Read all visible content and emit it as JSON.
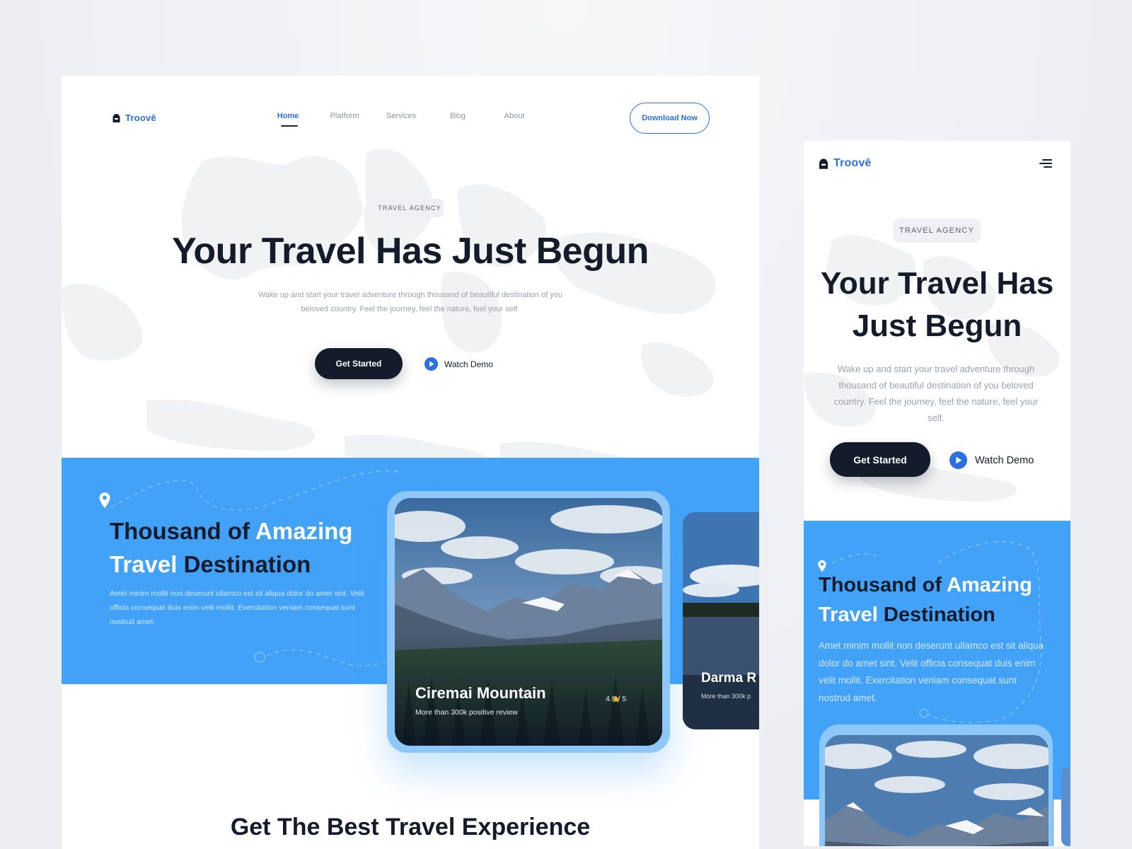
{
  "brand": {
    "name": "Troovē",
    "accent": "#2c6fe0",
    "dark": "#141b2b",
    "sky": "#42a2f8"
  },
  "desktop": {
    "nav": {
      "items": [
        {
          "label": "Home",
          "active": true
        },
        {
          "label": "Platform",
          "active": false
        },
        {
          "label": "Services",
          "active": false
        },
        {
          "label": "Blog",
          "active": false
        },
        {
          "label": "About",
          "active": false
        }
      ],
      "cta": "Download Now"
    },
    "hero": {
      "badge": "TRAVEL AGENCY",
      "title": "Your Travel Has Just Begun",
      "subtitle": "Wake up and start your travel adventure through thousand of beautiful destination of you beloved country. Feel the journey, feel the nature, feel your self.",
      "primary_button": "Get Started",
      "secondary_button": "Watch Demo",
      "secondary_icon": "play-icon"
    },
    "destinations": {
      "title_part1": "Thousand of ",
      "title_part2": "Amazing",
      "title_part3": "Travel",
      "title_part4": " Destination",
      "description": "Amet minim mollit non deserunt ullamco est sit aliqua dolor do amet sint. Velit officia consequat duis enim velit mollit. Exercitation veniam consequat sunt nostrud amet.",
      "pin_icon": "location-pin-icon",
      "cards": [
        {
          "name": "Ciremai Mountain",
          "review": "More than 300k positive review",
          "rating": "4.9 / 5"
        },
        {
          "name": "Darma R",
          "review": "More than 300k p"
        }
      ]
    },
    "next_section_title": "Get The Best Travel Experience"
  },
  "mobile": {
    "menu_icon": "menu-icon",
    "hero": {
      "badge": "TRAVEL AGENCY",
      "title_line1": "Your Travel Has",
      "title_line2": "Just Begun",
      "subtitle": "Wake up and start your travel  adventure through thousand of beautiful destination of you beloved country. Feel the journey, feel the nature, feel your self.",
      "primary_button": "Get Started",
      "secondary_button": "Watch Demo"
    },
    "destinations": {
      "title_part1": "Thousand of ",
      "title_part2": "Amazing",
      "title_part3": "Travel",
      "title_part4": " Destination",
      "description": "Amet minim mollit non deserunt ullamco est sit aliqua dolor do amet sint. Velit officia consequat duis enim velit mollit. Exercitation veniam consequat sunt nostrud amet."
    }
  }
}
